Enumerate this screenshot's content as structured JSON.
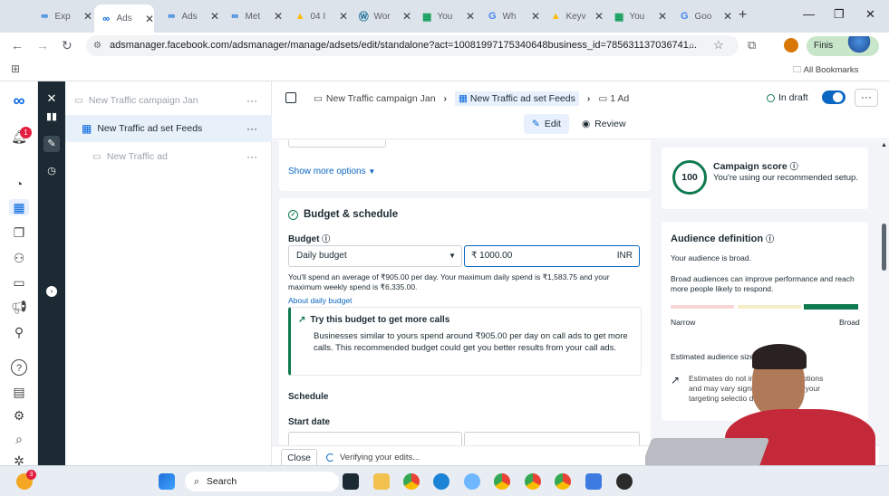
{
  "browser": {
    "tabs": [
      {
        "title": "Exp",
        "icon": "meta-icon"
      },
      {
        "title": "Ads",
        "icon": "meta-icon",
        "active": true
      },
      {
        "title": "Ads",
        "icon": "meta-icon"
      },
      {
        "title": "Met",
        "icon": "meta-icon"
      },
      {
        "title": "04 I",
        "icon": "drive-icon"
      },
      {
        "title": "Wor",
        "icon": "wordpress-icon"
      },
      {
        "title": "You",
        "icon": "sheets-icon"
      },
      {
        "title": "Wh",
        "icon": "google-icon"
      },
      {
        "title": "Keyv",
        "icon": "google-ads-icon"
      },
      {
        "title": "You",
        "icon": "sheets-icon"
      },
      {
        "title": "Goo",
        "icon": "google-icon"
      }
    ],
    "url": "adsmanager.facebook.com/adsmanager/manage/adsets/edit/standalone?act=10081997175340648business_id=785631137036741...",
    "finish_label": "Finis",
    "all_bookmarks": "All Bookmarks"
  },
  "rail": {
    "notification_count": "1"
  },
  "tree": {
    "campaign": "New Traffic campaign Jan",
    "adset": "New Traffic ad set Feeds",
    "ad": "New Traffic ad"
  },
  "header": {
    "crumb_campaign": "New Traffic campaign Jan",
    "crumb_adset": "New Traffic ad set Feeds",
    "crumb_ad": "1 Ad",
    "status": "In draft",
    "edit": "Edit",
    "review": "Review"
  },
  "main": {
    "show_more": "Show more options",
    "section_title": "Budget & schedule",
    "budget_label": "Budget",
    "budget_type": "Daily budget",
    "currency_symbol": "₹",
    "budget_value": "1000.00",
    "currency_code": "INR",
    "spend_note": "You'll spend an average of ₹905.00 per day. Your maximum daily spend is ₹1,583.75 and your maximum weekly spend is ₹6,335.00.",
    "about_link": "About daily budget",
    "tip_title": "Try this budget to get more calls",
    "tip_text": "Businesses similar to yours spend around ₹905.00 per day on call ads to get more calls. This recommended budget could get you better results from your call ads.",
    "schedule": "Schedule",
    "start_date": "Start date"
  },
  "side": {
    "score": "100",
    "score_title": "Campaign score",
    "score_text": "You're using our recommended setup.",
    "audience_title": "Audience definition",
    "audience_broad": "Your audience is broad.",
    "audience_note": "Broad audiences can improve performance and reach more people likely to respond.",
    "narrow": "Narrow",
    "broad": "Broad",
    "estimated": "Estimated audience size: 302,600,00",
    "estimates_note": "Estimates do not include Advan options and may vary significan based on your targeting selectio data."
  },
  "footer": {
    "close": "Close",
    "verifying": "Verifying your edits..."
  },
  "taskbar": {
    "search": "Search",
    "badge": "3"
  },
  "colors": {
    "meta_blue": "#0064e0",
    "green": "#0f7a4f",
    "dark_rail": "#1c2b33",
    "toggle": "#0a66c2"
  }
}
